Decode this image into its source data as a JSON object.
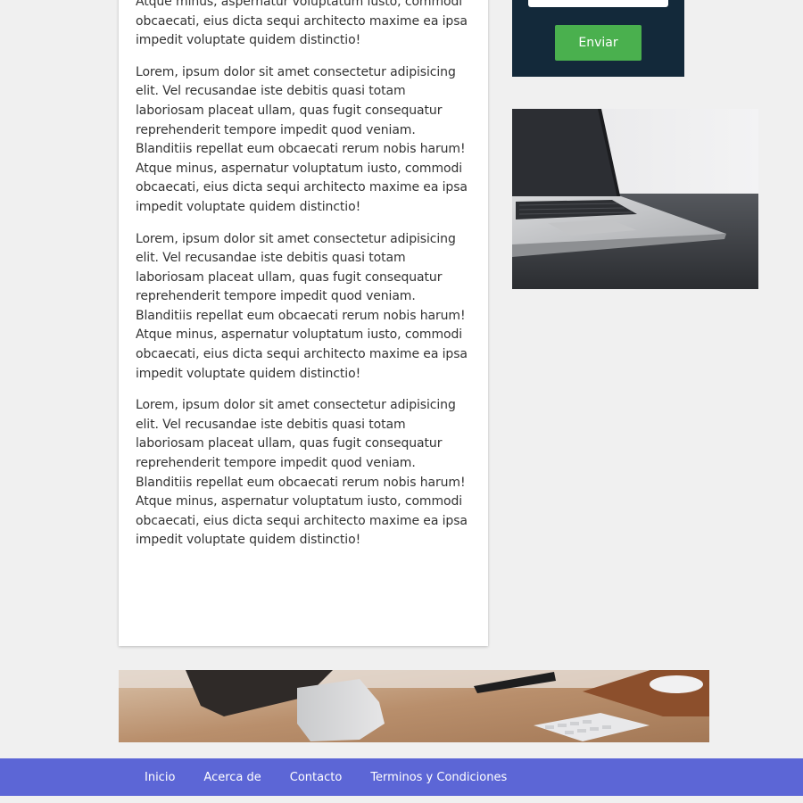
{
  "article": {
    "paragraphs": [
      "Lorem, ipsum dolor sit amet consectetur adipisicing elit. Vel recusandae iste debitis quasi totam laboriosam placeat ullam, quas fugit consequatur reprehenderit tempore impedit quod veniam. Blanditiis repellat eum obcaecati rerum nobis harum! Atque minus, aspernatur voluptatum iusto, commodi obcaecati, eius dicta sequi architecto maxime ea ipsa impedit voluptate quidem distinctio!",
      "Lorem, ipsum dolor sit amet consectetur adipisicing elit. Vel recusandae iste debitis quasi totam laboriosam placeat ullam, quas fugit consequatur reprehenderit tempore impedit quod veniam. Blanditiis repellat eum obcaecati rerum nobis harum! Atque minus, aspernatur voluptatum iusto, commodi obcaecati, eius dicta sequi architecto maxime ea ipsa impedit voluptate quidem distinctio!",
      "Lorem, ipsum dolor sit amet consectetur adipisicing elit. Vel recusandae iste debitis quasi totam laboriosam placeat ullam, quas fugit consequatur reprehenderit tempore impedit quod veniam. Blanditiis repellat eum obcaecati rerum nobis harum! Atque minus, aspernatur voluptatum iusto, commodi obcaecati, eius dicta sequi architecto maxime ea ipsa impedit voluptate quidem distinctio!",
      "Lorem, ipsum dolor sit amet consectetur adipisicing elit. Vel recusandae iste debitis quasi totam laboriosam placeat ullam, quas fugit consequatur reprehenderit tempore impedit quod veniam. Blanditiis repellat eum obcaecati rerum nobis harum! Atque minus, aspernatur voluptatum iusto, commodi obcaecati, eius dicta sequi architecto maxime ea ipsa impedit voluptate quidem distinctio!"
    ]
  },
  "sidebar": {
    "form": {
      "submit_label": "Enviar",
      "input_value": ""
    }
  },
  "footer": {
    "nav": [
      {
        "label": "Inicio"
      },
      {
        "label": "Acerca de"
      },
      {
        "label": "Contacto"
      },
      {
        "label": "Terminos y Condiciones"
      }
    ]
  },
  "colors": {
    "page_background": "#f0f0f0",
    "form_panel": "#13293a",
    "submit_button": "#4ab04e",
    "footer": "#5c66d6"
  }
}
